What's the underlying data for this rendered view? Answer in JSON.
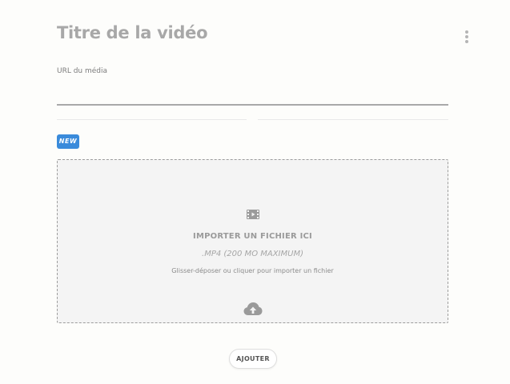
{
  "header": {
    "title": "Titre de la vidéo"
  },
  "url_field": {
    "label": "URL du média",
    "value": "",
    "placeholder": ""
  },
  "badge": {
    "label": "NEW",
    "color": "#3a8bdb"
  },
  "dropzone": {
    "icon": "film-icon",
    "title": "IMPORTER UN FICHIER ICI",
    "format": ".MP4 (200 MO MAXIMUM)",
    "hint": "Glisser-déposer ou cliquer pour importer un fichier",
    "upload_icon": "cloud-upload-icon"
  },
  "actions": {
    "add_label": "AJOUTER"
  },
  "menu": {
    "icon": "more-vertical-icon"
  }
}
